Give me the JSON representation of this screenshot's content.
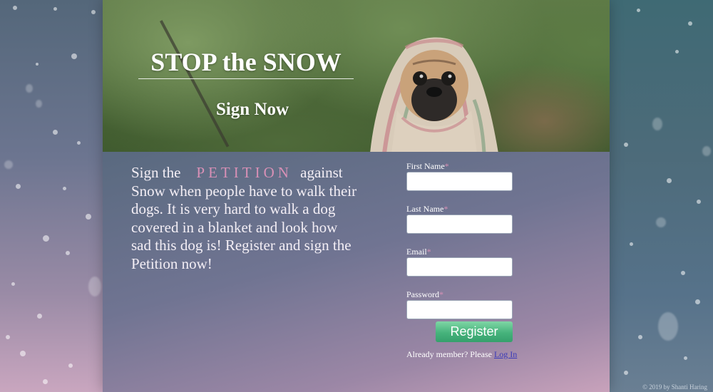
{
  "hero": {
    "title": "STOP the SNOW",
    "sign_link": "Sign Now"
  },
  "blurb": {
    "prefix": "Sign the",
    "highlight": "PETITION",
    "suffix": " against Snow when people have to walk their dogs. It is very hard to walk a dog covered in a blanket and look how sad this dog is! Register and sign the Petition now!"
  },
  "form": {
    "required_mark": "*",
    "fields": [
      {
        "label": "First Name",
        "value": ""
      },
      {
        "label": "Last Name",
        "value": ""
      },
      {
        "label": "Email",
        "value": ""
      },
      {
        "label": "Password",
        "value": ""
      }
    ],
    "register_label": "Register",
    "already_text": "Already member? Please ",
    "login_label": "Log In"
  },
  "footer": {
    "copyright": "© 2019 by Shanti Haring"
  },
  "colors": {
    "accent_pink": "#d890b6",
    "register_green": "#46b37c",
    "link_blue": "#3a3ab8"
  }
}
